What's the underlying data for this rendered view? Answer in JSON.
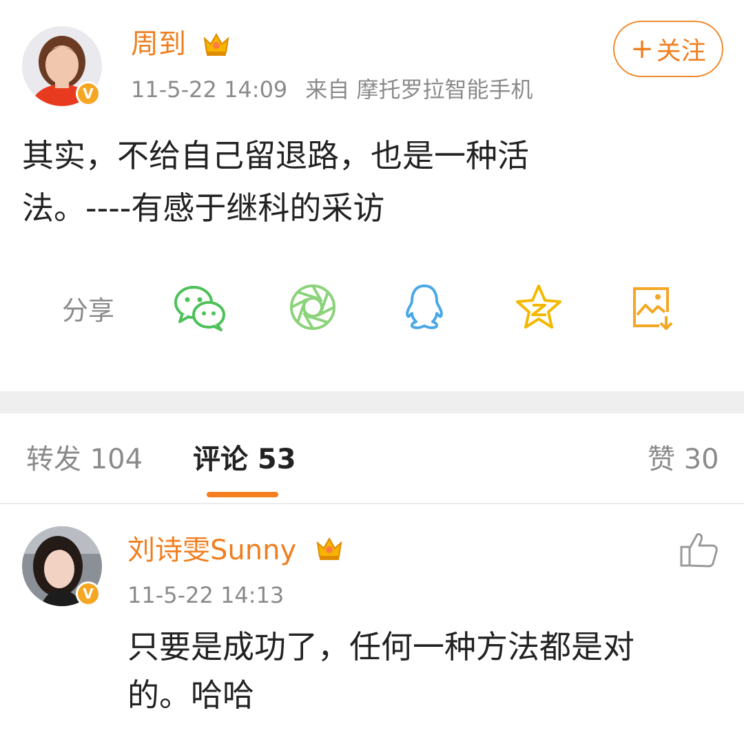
{
  "post": {
    "author": {
      "name": "周到",
      "avatar": "woman-red-top-avatar",
      "verified_badge": "V",
      "crown_icon": "vip-crown-icon"
    },
    "time": "11-5-22 14:09",
    "source": "来自 摩托罗拉智能手机",
    "follow_button": {
      "plus": "+",
      "label": "关注"
    },
    "text_line1": "其实，不给自己留退路，也是一种活",
    "text_line2": "法。----有感于继科的采访",
    "share": {
      "label": "分享",
      "targets": [
        "wechat-icon",
        "moments-icon",
        "qq-icon",
        "qzone-icon",
        "save-image-icon"
      ]
    }
  },
  "tabs": {
    "repost": "转发 104",
    "comments": "评论 53",
    "likes": "赞 30",
    "active": "comments"
  },
  "comment": {
    "name": "刘诗雯Sunny",
    "avatar": "woman-car-avatar",
    "verified_badge": "V",
    "crown_icon": "vip-crown-icon",
    "time": "11-5-22 14:13",
    "text_line1": "只要是成功了，任何一种方法都是对",
    "text_line2": "的。哈哈",
    "like_icon": "thumbs-up-icon"
  },
  "colors": {
    "accent": "#f07e1f",
    "muted": "#8a8a8a",
    "wechat": "#4cc15a",
    "moments": "#8bd37a",
    "qq": "#4aa8e6",
    "qzone": "#f5b800",
    "save": "#f5a623"
  }
}
